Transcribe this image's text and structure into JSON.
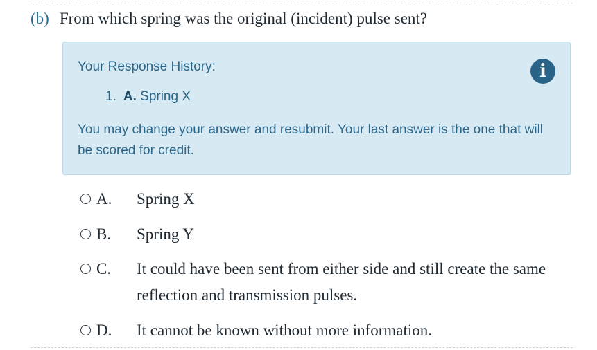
{
  "question": {
    "label": "(b)",
    "text": "From which spring was the original (incident) pulse sent?"
  },
  "response_history": {
    "title": "Your Response History:",
    "items": [
      {
        "number": "1.",
        "letter": "A.",
        "text": "Spring X"
      }
    ],
    "note": "You may change your answer and resubmit. Your last answer is the one that will be scored for credit.",
    "icon": "info-icon"
  },
  "options": [
    {
      "letter": "A.",
      "text": "Spring X"
    },
    {
      "letter": "B.",
      "text": "Spring Y"
    },
    {
      "letter": "C.",
      "text": "It could have been sent from either side and still create the same reflection and transmission pulses."
    },
    {
      "letter": "D.",
      "text": "It cannot be known without more information."
    }
  ],
  "colors": {
    "accent": "#2b6d8f",
    "info_bg": "#d7eaf4",
    "info_text": "#2b6587",
    "info_icon_bg": "#2a6388"
  }
}
